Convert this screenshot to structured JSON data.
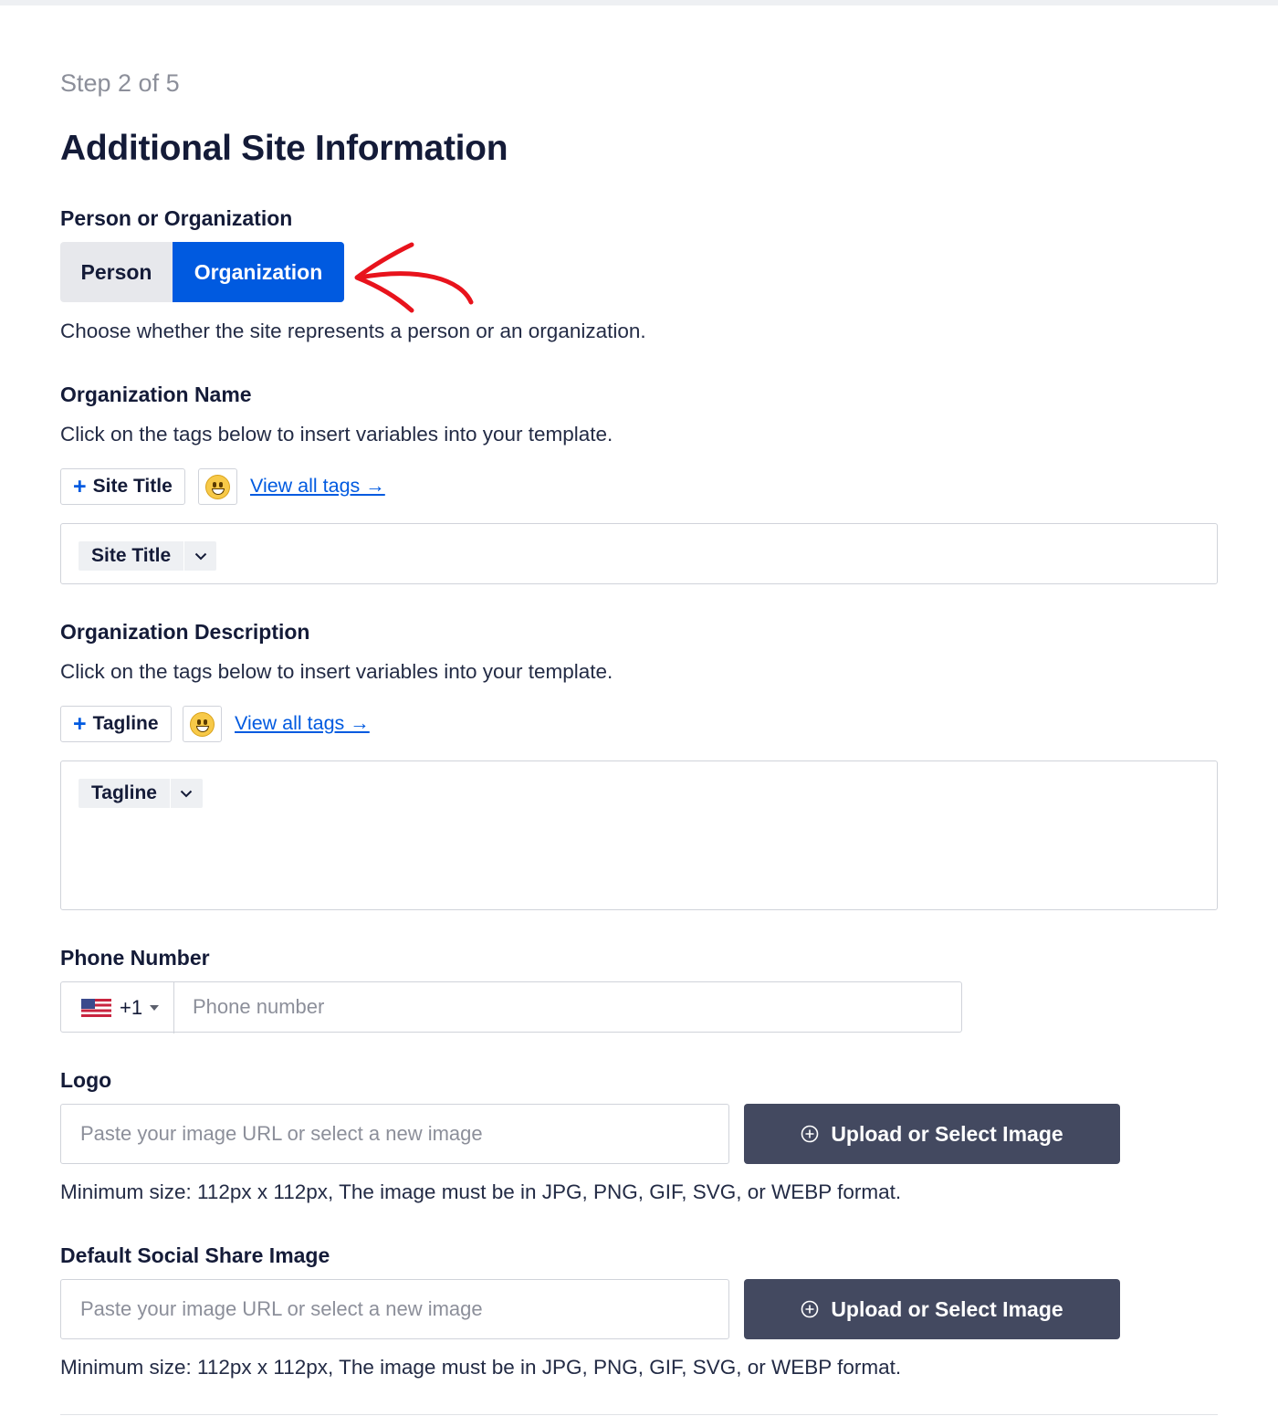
{
  "step": "Step 2 of 5",
  "title": "Additional Site Information",
  "person_or_org": {
    "label": "Person or Organization",
    "options": [
      "Person",
      "Organization"
    ],
    "selected": "Organization",
    "description": "Choose whether the site represents a person or an organization."
  },
  "org_name": {
    "label": "Organization Name",
    "description": "Click on the tags below to insert variables into your template.",
    "tag_button": "Site Title",
    "view_all": "View all tags →",
    "chip": "Site Title"
  },
  "org_desc": {
    "label": "Organization Description",
    "description": "Click on the tags below to insert variables into your template.",
    "tag_button": "Tagline",
    "view_all": "View all tags →",
    "chip": "Tagline"
  },
  "phone": {
    "label": "Phone Number",
    "country_code": "+1",
    "placeholder": "Phone number"
  },
  "logo": {
    "label": "Logo",
    "placeholder": "Paste your image URL or select a new image",
    "button": "Upload or Select Image",
    "help": "Minimum size: 112px x 112px, The image must be in JPG, PNG, GIF, SVG, or WEBP format."
  },
  "social": {
    "label": "Default Social Share Image",
    "placeholder": "Paste your image URL or select a new image",
    "button": "Upload or Select Image",
    "help": "Minimum size: 112px x 112px, The image must be in JPG, PNG, GIF, SVG, or WEBP format."
  },
  "colors": {
    "accent": "#005ae0",
    "dark_button": "#434960",
    "annotation_arrow": "#e8131c"
  }
}
